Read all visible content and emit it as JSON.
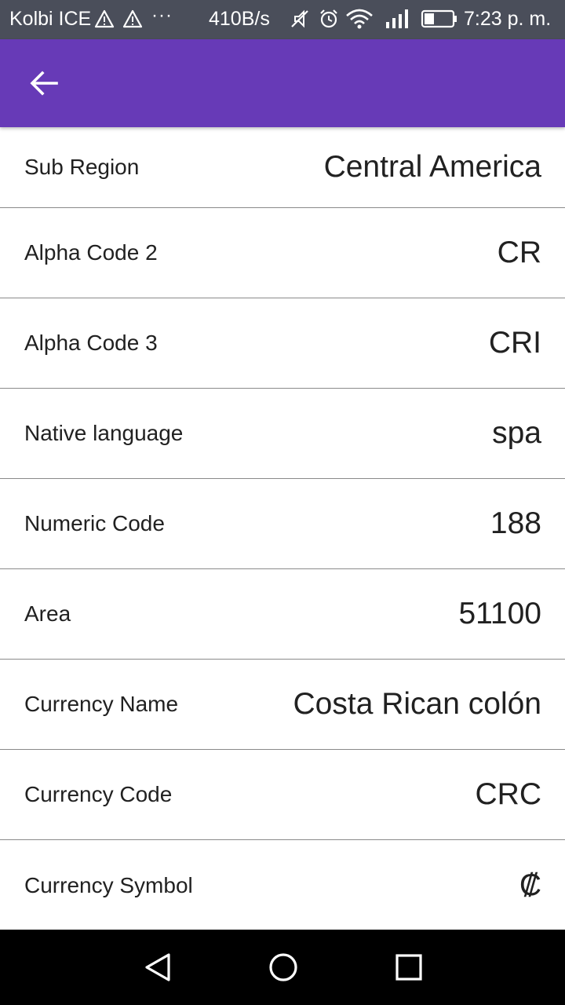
{
  "status_bar": {
    "carrier": "Kolbi ICE",
    "dots": "···",
    "speed": "410B/s",
    "time": "7:23 p. m.",
    "icons": [
      "warning-icon",
      "warning-icon",
      "mute-icon",
      "alarm-icon",
      "wifi-icon",
      "signal-icon",
      "battery-icon"
    ]
  },
  "app_bar": {
    "back_icon": "arrow-left-icon",
    "accent_color": "#673ab7"
  },
  "details": [
    {
      "label": "Sub Region",
      "value": "Central America"
    },
    {
      "label": "Alpha Code 2",
      "value": "CR"
    },
    {
      "label": "Alpha Code 3",
      "value": "CRI"
    },
    {
      "label": "Native language",
      "value": "spa"
    },
    {
      "label": "Numeric Code",
      "value": "188"
    },
    {
      "label": "Area",
      "value": "51100"
    },
    {
      "label": "Currency Name",
      "value": "Costa Rican colón"
    },
    {
      "label": "Currency Code",
      "value": "CRC"
    },
    {
      "label": "Currency Symbol",
      "value": "₡"
    }
  ],
  "nav_bar": {
    "icons": [
      "back-triangle-icon",
      "home-circle-icon",
      "recents-square-icon"
    ]
  }
}
